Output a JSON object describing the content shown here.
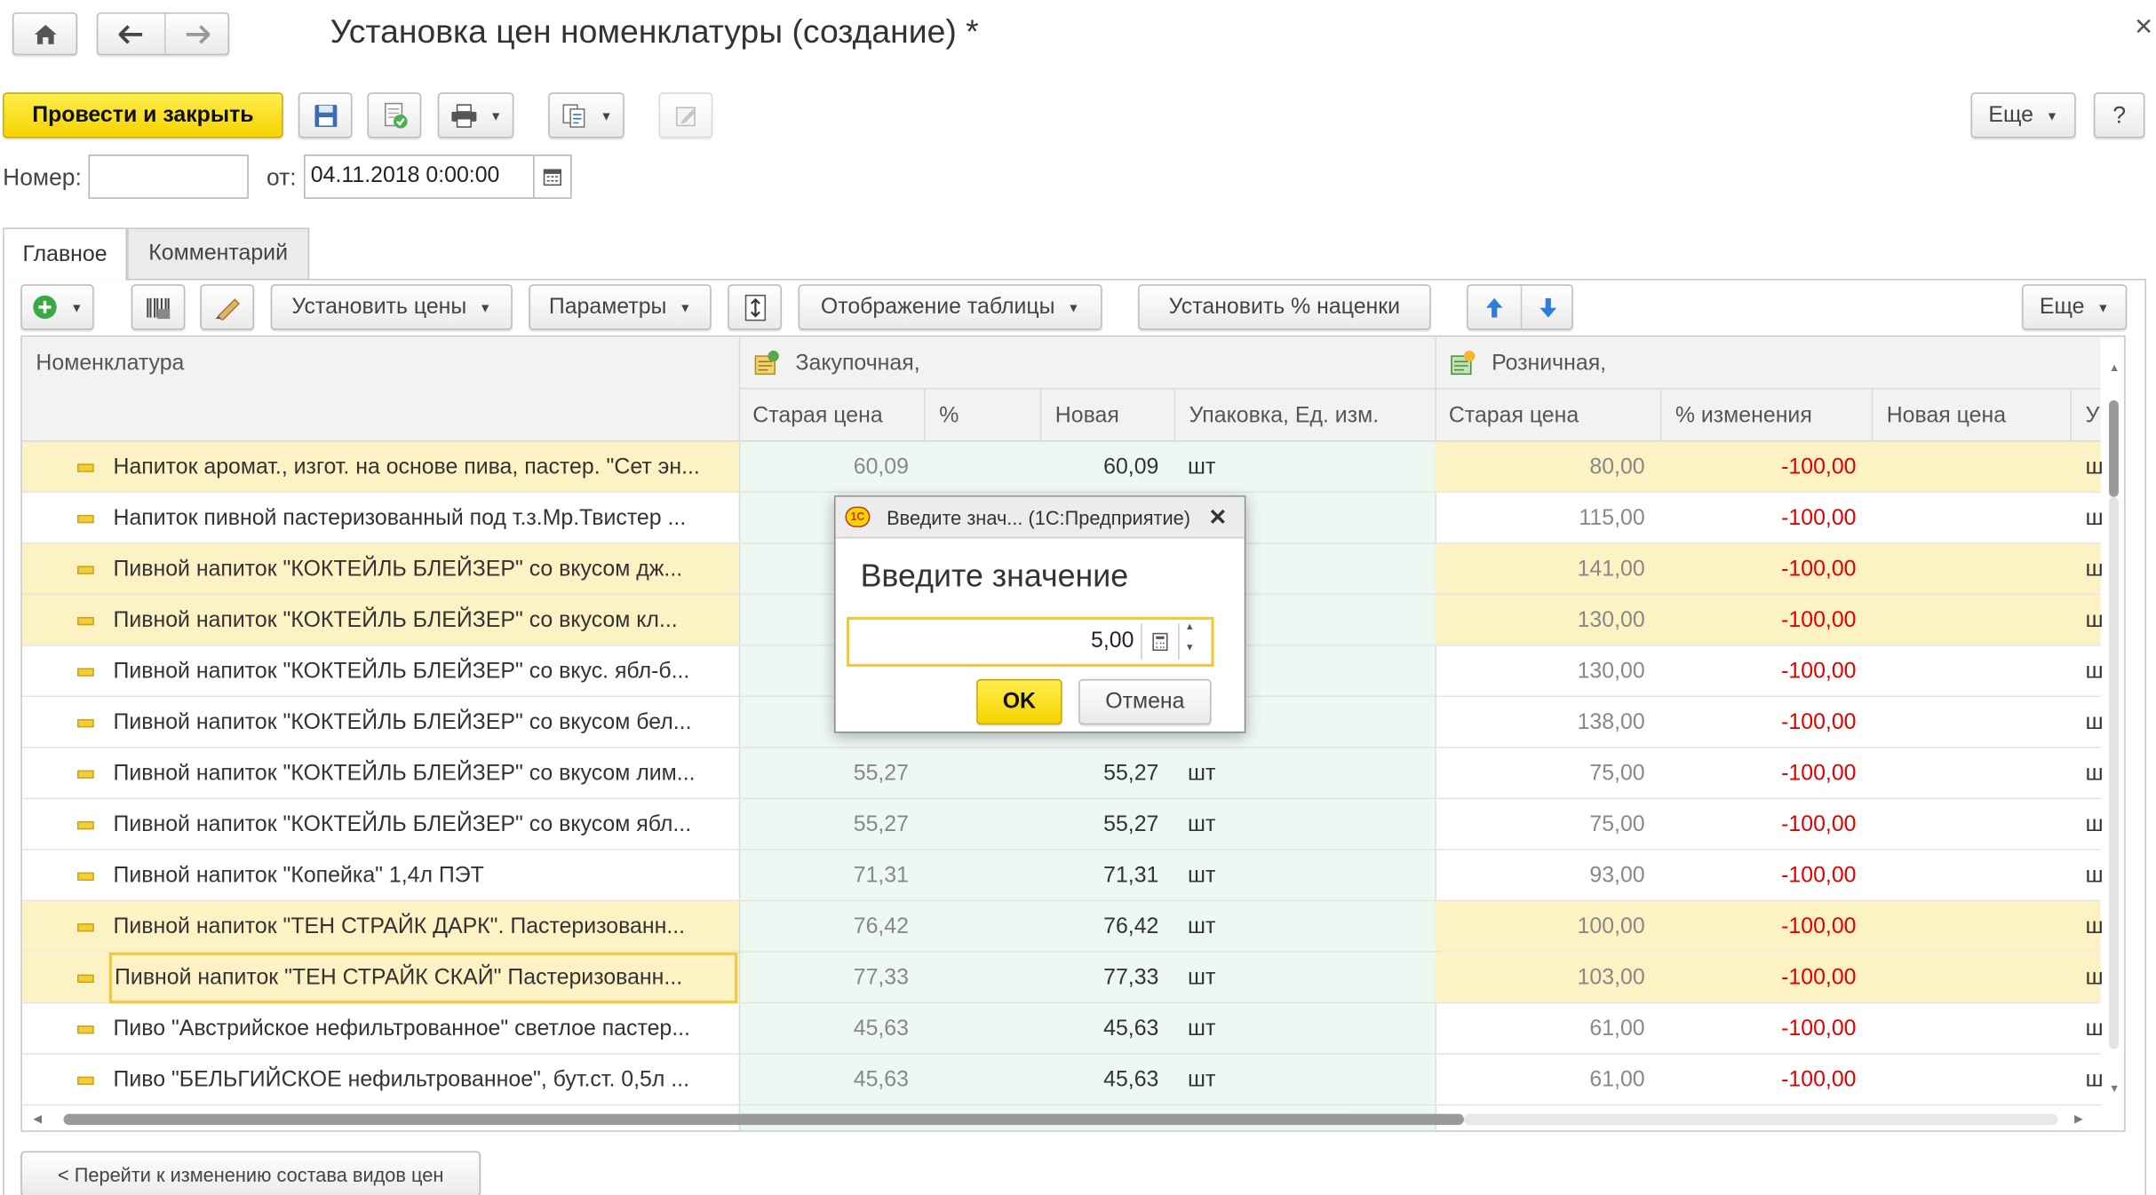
{
  "window": {
    "title": "Установка цен номенклатуры (создание) *",
    "close": "✕"
  },
  "toolbar": {
    "post_and_close": "Провести и закрыть",
    "more": "Еще",
    "help": "?"
  },
  "header_fields": {
    "number_label": "Номер:",
    "number_value": "",
    "from_label": "от:",
    "date_value": "04.11.2018  0:00:00"
  },
  "tabs": [
    {
      "label": "Главное",
      "active": true
    },
    {
      "label": "Комментарий",
      "active": false
    }
  ],
  "table_toolbar": {
    "set_prices": "Установить цены",
    "parameters": "Параметры",
    "table_view": "Отображение таблицы",
    "set_markup": "Установить % наценки",
    "more": "Еще"
  },
  "table": {
    "headers": {
      "nomenclature": "Номенклатура",
      "purchase_group": "Закупочная,",
      "retail_group": "Розничная,",
      "old_price": "Старая цена",
      "percent": "%",
      "new": "Новая",
      "pack_unit": "Упаковка, Ед. изм.",
      "retail_old_price": "Старая цена",
      "change_percent": "% изменения",
      "new_price": "Новая цена",
      "cut_u": "У"
    },
    "rows": [
      {
        "name": "Напиток аромат., изгот. на основе пива, пастер. \"Сет эн...",
        "old": "60,09",
        "pct": "",
        "new": "60,09",
        "unit": "шт",
        "r_old": "80,00",
        "r_pct": "-100,00",
        "r_new": "",
        "cut": "ш",
        "highlight": true
      },
      {
        "name": "Напиток пивной пастеризованный под т.з.Мр.Твистер ...",
        "old": "",
        "pct": "",
        "new": "",
        "unit": "",
        "r_old": "115,00",
        "r_pct": "-100,00",
        "r_new": "",
        "cut": "ш",
        "highlight": false
      },
      {
        "name": "Пивной напиток \"КОКТЕЙЛЬ БЛЕЙЗЕР\"  со вкусом дж...",
        "old": "",
        "pct": "",
        "new": "",
        "unit": "",
        "r_old": "141,00",
        "r_pct": "-100,00",
        "r_new": "",
        "cut": "ш",
        "highlight": true
      },
      {
        "name": "Пивной напиток \"КОКТЕЙЛЬ БЛЕЙЗЕР\"  со вкусом кл...",
        "old": "",
        "pct": "",
        "new": "",
        "unit": "",
        "r_old": "130,00",
        "r_pct": "-100,00",
        "r_new": "",
        "cut": "ш",
        "highlight": true
      },
      {
        "name": "Пивной напиток \"КОКТЕЙЛЬ БЛЕЙЗЕР\" со вкус. ябл-б...",
        "old": "",
        "pct": "",
        "new": "",
        "unit": "",
        "r_old": "130,00",
        "r_pct": "-100,00",
        "r_new": "",
        "cut": "ш",
        "highlight": false
      },
      {
        "name": "Пивной напиток \"КОКТЕЙЛЬ БЛЕЙЗЕР\" со вкусом бел...",
        "old": "",
        "pct": "",
        "new": "",
        "unit": "",
        "r_old": "138,00",
        "r_pct": "-100,00",
        "r_new": "",
        "cut": "ш",
        "highlight": false
      },
      {
        "name": "Пивной напиток \"КОКТЕЙЛЬ БЛЕЙЗЕР\" со вкусом лим...",
        "old": "55,27",
        "pct": "",
        "new": "55,27",
        "unit": "шт",
        "r_old": "75,00",
        "r_pct": "-100,00",
        "r_new": "",
        "cut": "ш",
        "highlight": false
      },
      {
        "name": "Пивной напиток \"КОКТЕЙЛЬ БЛЕЙЗЕР\" со вкусом ябл...",
        "old": "55,27",
        "pct": "",
        "new": "55,27",
        "unit": "шт",
        "r_old": "75,00",
        "r_pct": "-100,00",
        "r_new": "",
        "cut": "ш",
        "highlight": false
      },
      {
        "name": "Пивной напиток \"Копейка\" 1,4л ПЭТ",
        "old": "71,31",
        "pct": "",
        "new": "71,31",
        "unit": "шт",
        "r_old": "93,00",
        "r_pct": "-100,00",
        "r_new": "",
        "cut": "ш",
        "highlight": false
      },
      {
        "name": "Пивной напиток \"ТЕН СТРАЙК ДАРК\". Пастеризованн...",
        "old": "76,42",
        "pct": "",
        "new": "76,42",
        "unit": "шт",
        "r_old": "100,00",
        "r_pct": "-100,00",
        "r_new": "",
        "cut": "ш",
        "highlight": true
      },
      {
        "name": "Пивной напиток \"ТЕН СТРАЙК СКАЙ\" Пастеризованн...",
        "old": "77,33",
        "pct": "",
        "new": "77,33",
        "unit": "шт",
        "r_old": "103,00",
        "r_pct": "-100,00",
        "r_new": "",
        "cut": "ш",
        "highlight": true,
        "current": true
      },
      {
        "name": "Пиво \"Австрийское нефильтрованное\" светлое пастер...",
        "old": "45,63",
        "pct": "",
        "new": "45,63",
        "unit": "шт",
        "r_old": "61,00",
        "r_pct": "-100,00",
        "r_new": "",
        "cut": "ш",
        "highlight": false
      },
      {
        "name": "Пиво \"БЕЛЬГИЙСКОЕ нефильтрованное\", бут.ст. 0,5л ...",
        "old": "45,63",
        "pct": "",
        "new": "45,63",
        "unit": "шт",
        "r_old": "61,00",
        "r_pct": "-100,00",
        "r_new": "",
        "cut": "ш",
        "highlight": false
      }
    ]
  },
  "dialog": {
    "title": "Введите знач...  (1С:Предприятие)",
    "heading": "Введите значение",
    "value": "5,00",
    "ok": "OK",
    "cancel": "Отмена",
    "close": "✕",
    "logo": "1С"
  },
  "footer": {
    "back_button": "< Перейти к изменению состава видов цен"
  },
  "colors": {
    "accent_yellow": "#f5d400",
    "row_highlight": "#fdf2c4",
    "purchase_column_tint": "#eef8f3",
    "negative_red": "#e00000"
  },
  "icons": {
    "home": "home-icon",
    "back": "arrow-left-icon",
    "forward": "arrow-right-icon",
    "save": "floppy-disk-icon",
    "post": "post-document-icon",
    "print": "printer-icon",
    "related": "related-documents-icon",
    "edit": "edit-icon",
    "add": "plus-circle-icon",
    "barcode": "barcode-icon",
    "pick": "pick-items-icon",
    "row_height": "row-height-icon",
    "move_up": "arrow-up-icon",
    "move_down": "arrow-down-icon",
    "calendar": "calendar-icon",
    "calculator": "calculator-icon"
  }
}
